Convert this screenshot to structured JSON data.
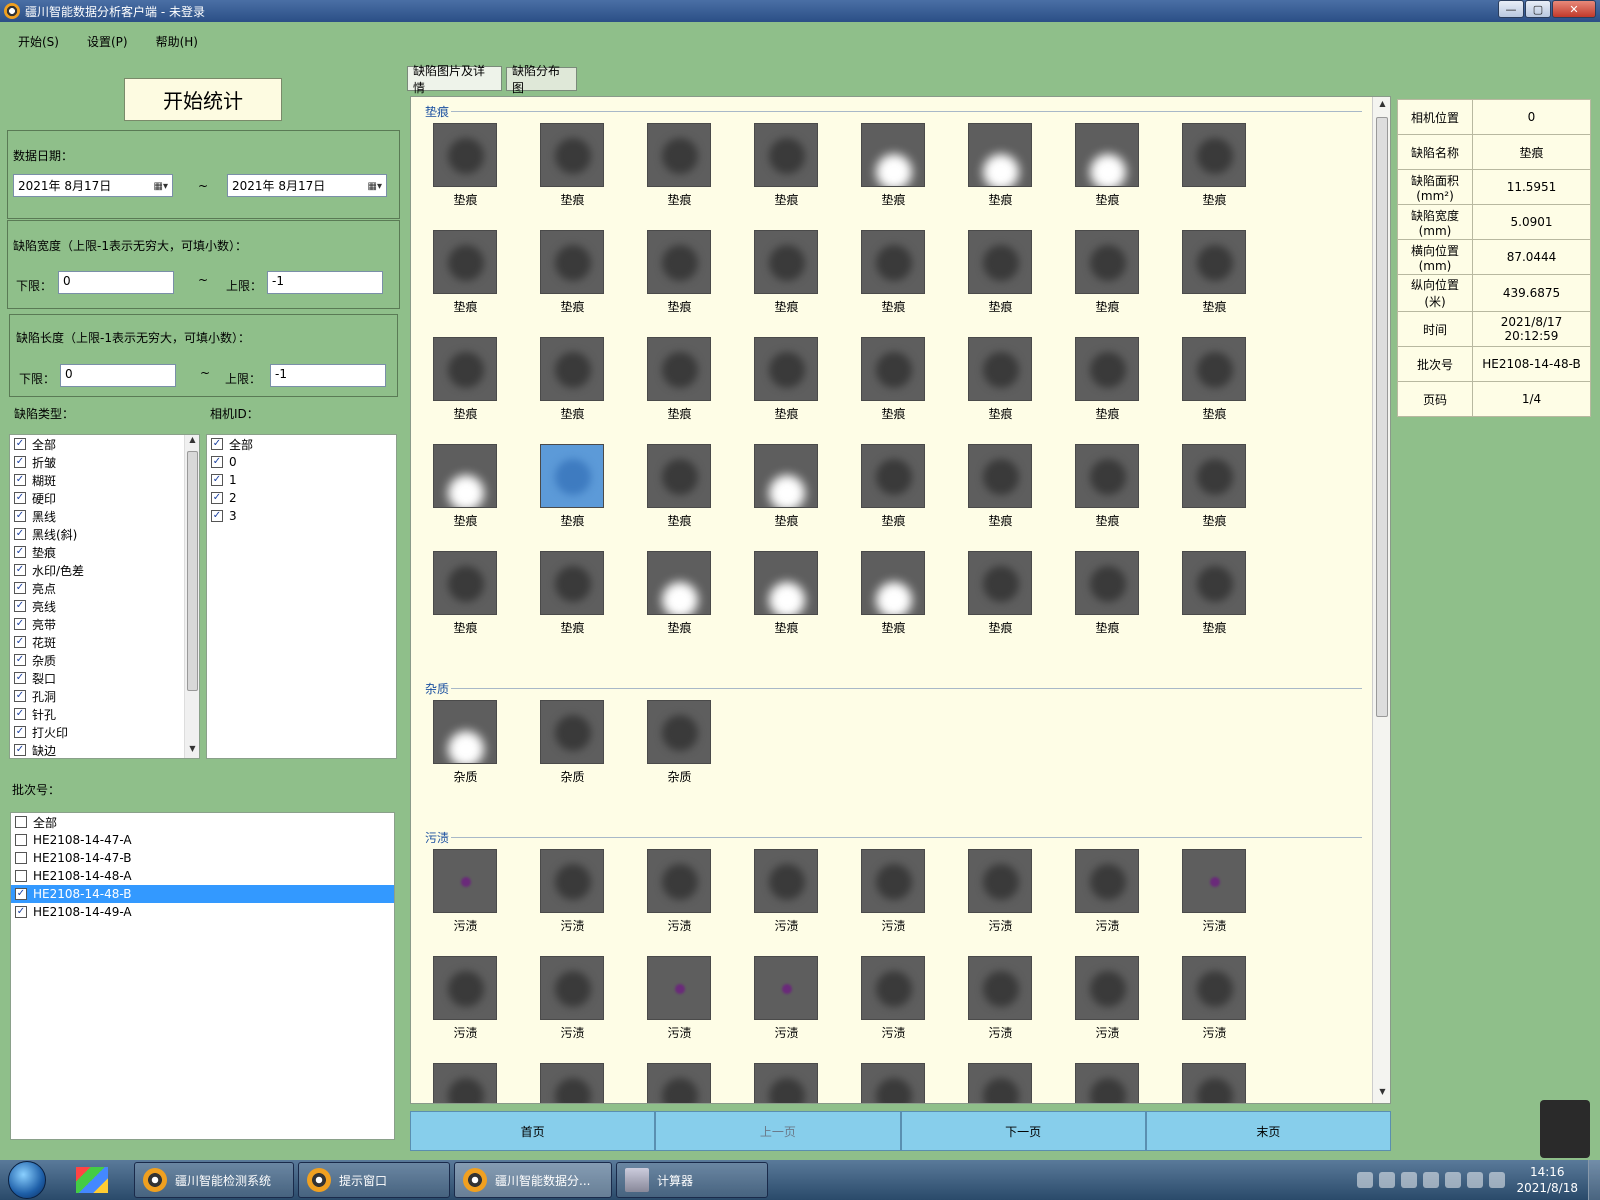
{
  "window": {
    "title": "疆川智能数据分析客户端 - 未登录"
  },
  "menu": [
    "开始(S)",
    "设置(P)",
    "帮助(H)"
  ],
  "left": {
    "start_label": "开始统计",
    "date_label": "数据日期：",
    "date_from": "2021年  8月17日",
    "date_to": "2021年  8月17日",
    "tilde": "~",
    "width_label": "缺陷宽度（上限-1表示无穷大，可填小数）：",
    "length_label": "缺陷长度（上限-1表示无穷大，可填小数）：",
    "lower_label": "下限：",
    "upper_label": "上限：",
    "width_lower": "0",
    "width_upper": "-1",
    "length_lower": "0",
    "length_upper": "-1",
    "type_label": "缺陷类型：",
    "camera_label": "相机ID：",
    "types": [
      "全部",
      "折皱",
      "糊斑",
      "硬印",
      "黑线",
      "黑线(斜)",
      "垫痕",
      "水印/色差",
      "亮点",
      "亮线",
      "亮带",
      "花斑",
      "杂质",
      "裂口",
      "孔洞",
      "针孔",
      "打火印",
      "缺边"
    ],
    "cameras": [
      "全部",
      "0",
      "1",
      "2",
      "3"
    ],
    "batch_label": "批次号：",
    "batches": [
      {
        "name": "全部",
        "checked": false
      },
      {
        "name": "HE2108-14-47-A",
        "checked": false
      },
      {
        "name": "HE2108-14-47-B",
        "checked": false
      },
      {
        "name": "HE2108-14-48-A",
        "checked": false
      },
      {
        "name": "HE2108-14-48-B",
        "checked": true,
        "selected": true
      },
      {
        "name": "HE2108-14-49-A",
        "checked": true
      }
    ]
  },
  "tabs": [
    "缺陷图片及详情",
    "缺陷分布图"
  ],
  "gallery": {
    "categories": [
      {
        "name": "垫痕",
        "rows": 5,
        "per_row": 8,
        "label": "垫痕"
      },
      {
        "name": "杂质",
        "rows": 1,
        "per_row": 3,
        "label": "杂质"
      },
      {
        "name": "污渍",
        "rows": 3,
        "per_row": 8,
        "label": "污渍"
      }
    ]
  },
  "pager": [
    "首页",
    "上一页",
    "下一页",
    "末页"
  ],
  "details": [
    {
      "k": "相机位置",
      "v": "0"
    },
    {
      "k": "缺陷名称",
      "v": "垫痕"
    },
    {
      "k": "缺陷面积\n(mm²)",
      "v": "11.5951"
    },
    {
      "k": "缺陷宽度\n(mm)",
      "v": "5.0901"
    },
    {
      "k": "横向位置\n(mm)",
      "v": "87.0444"
    },
    {
      "k": "纵向位置\n(米)",
      "v": "439.6875"
    },
    {
      "k": "时间",
      "v": "2021/8/17\n20:12:59"
    },
    {
      "k": "批次号",
      "v": "HE2108-14-48-B"
    },
    {
      "k": "页码",
      "v": "1/4"
    }
  ],
  "taskbar": {
    "tasks": [
      "疆川智能检测系统",
      "提示窗口",
      "疆川智能数据分...",
      "计算器"
    ],
    "time": "14:16",
    "date": "2021/8/18"
  }
}
